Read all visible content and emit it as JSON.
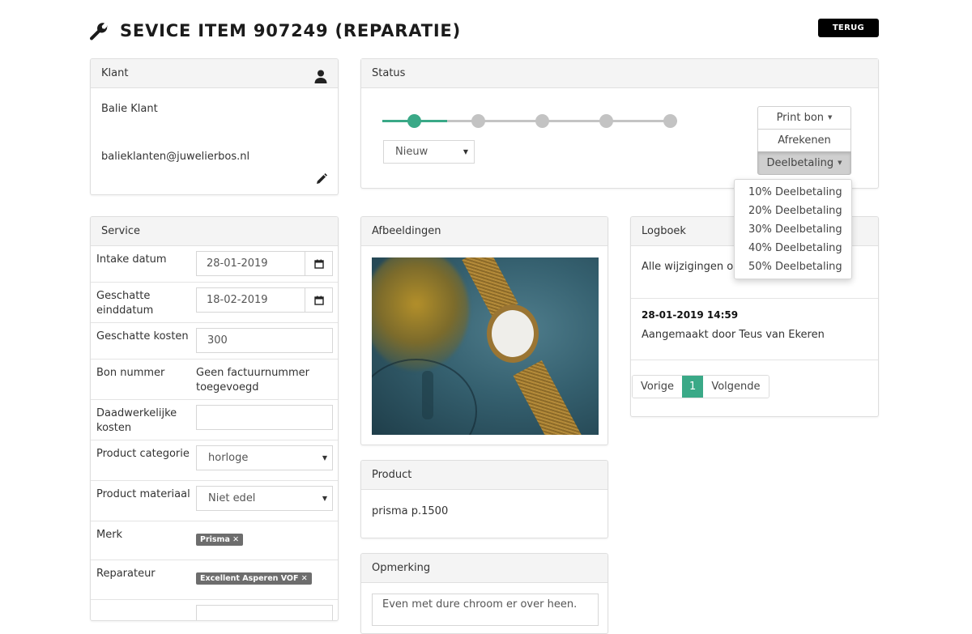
{
  "header": {
    "title": "SEVICE ITEM 907249 (REPARATIE)",
    "title_icon": "wrench-icon",
    "back_button": "TERUG"
  },
  "klant": {
    "heading": "Klant",
    "icon": "user-icon",
    "name": "Balie Klant",
    "email": "balieklanten@juwelierbos.nl",
    "edit_icon": "pencil-icon"
  },
  "status": {
    "heading": "Status",
    "steps_total": 5,
    "current_step": 1,
    "selected_status": "Nieuw",
    "buttons": {
      "print": "Print bon",
      "checkout": "Afrekenen",
      "partial": "Deelbetaling"
    },
    "partial_menu": [
      "10% Deelbetaling",
      "20% Deelbetaling",
      "30% Deelbetaling",
      "40% Deelbetaling",
      "50% Deelbetaling"
    ],
    "accent_color": "#3aa987"
  },
  "service": {
    "heading": "Service",
    "rows": {
      "intake": {
        "label": "Intake datum",
        "value": "28-01-2019"
      },
      "end_date": {
        "label": "Geschatte einddatum",
        "value": "18-02-2019"
      },
      "est_cost": {
        "label": "Geschatte kosten",
        "value": "300"
      },
      "receipt": {
        "label": "Bon nummer",
        "value": "Geen factuurnummer toegevoegd"
      },
      "actual_cost": {
        "label": "Daadwerkelijke kosten",
        "value": ""
      },
      "category": {
        "label": "Product categorie",
        "value": "horloge"
      },
      "material": {
        "label": "Product materiaal",
        "value": "Niet edel"
      },
      "brand": {
        "label": "Merk",
        "tag": "Prisma ✕"
      },
      "repairer": {
        "label": "Reparateur",
        "tag": "Excellent Asperen VOF ✕"
      }
    }
  },
  "images": {
    "heading": "Afbeeldingen"
  },
  "product": {
    "heading": "Product",
    "value": "prisma p.1500"
  },
  "remark": {
    "heading": "Opmerking",
    "value": "Even met dure chroom er over heen."
  },
  "log": {
    "heading": "Logboek",
    "intro": "Alle wijzigingen op",
    "entries": [
      {
        "time": "28-01-2019 14:59",
        "message": "Aangemaakt door Teus van Ekeren"
      }
    ],
    "pager": {
      "prev": "Vorige",
      "current": "1",
      "next": "Volgende"
    }
  }
}
